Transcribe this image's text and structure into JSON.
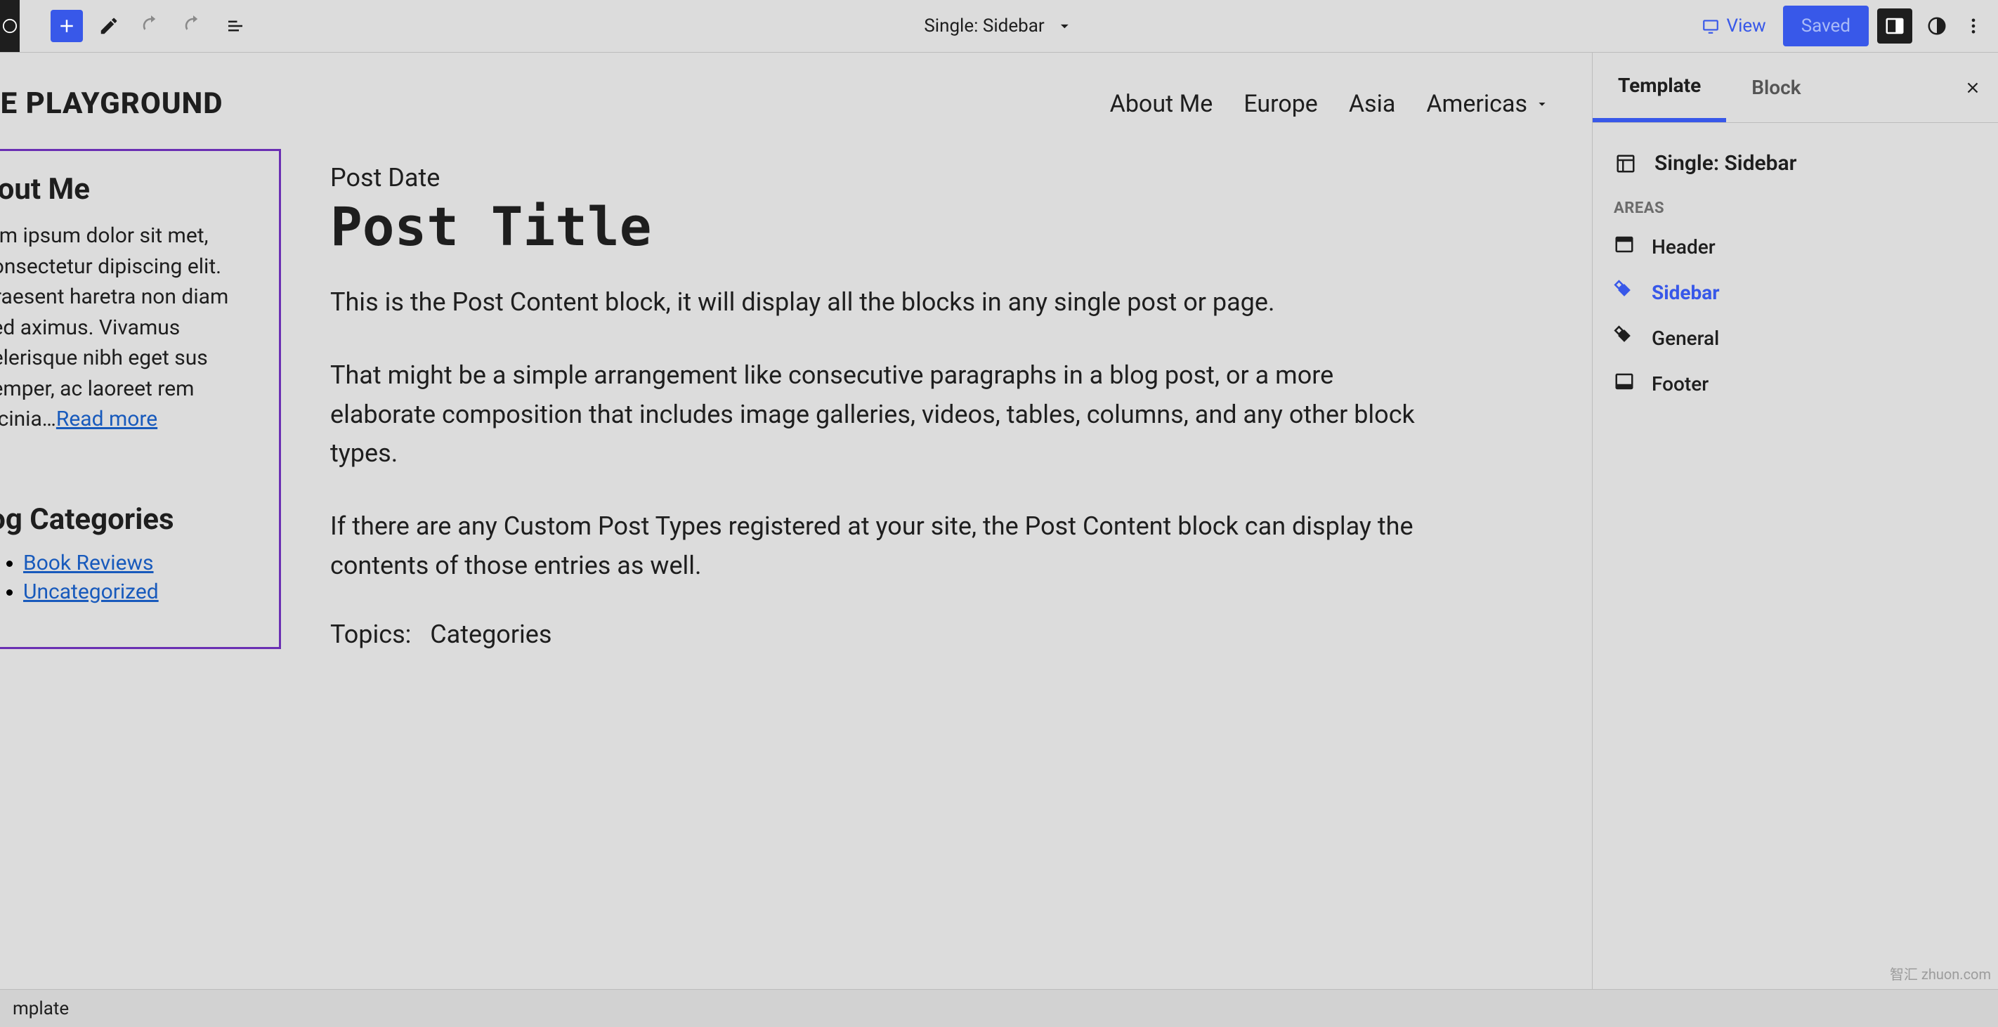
{
  "topbar": {
    "center_label": "Single: Sidebar",
    "view_label": "View",
    "saved_label": "Saved"
  },
  "site": {
    "title": "HE PLAYGROUND",
    "nav": {
      "about": "About Me",
      "europe": "Europe",
      "asia": "Asia",
      "americas": "Americas"
    }
  },
  "sidebar_block": {
    "about": {
      "heading": "bout Me",
      "text": "rem ipsum dolor sit met, consectetur dipiscing elit. Praesent haretra non diam sed aximus. Vivamus celerisque nibh eget sus semper, ac laoreet rem lacinia…",
      "read_more": "Read more "
    },
    "categories": {
      "heading": "log Categories",
      "items": {
        "0": "Book Reviews",
        "1": "Uncategorized"
      }
    }
  },
  "post": {
    "date": "Post Date",
    "title": "Post Title",
    "p1": "This is the Post Content block, it will display all the blocks in any single post or page.",
    "p2": "That might be a simple arrangement like consecutive paragraphs in a blog post, or a more elaborate composition that includes image galleries, videos, tables, columns, and any other block types.",
    "p3": "If there are any Custom Post Types registered at your site, the Post Content block can display the contents of those entries as well.",
    "topics_label": "Topics:",
    "topics_value": "Categories"
  },
  "settings": {
    "tabs": {
      "template": "Template",
      "block": "Block"
    },
    "template_name": "Single: Sidebar",
    "areas_label": "AREAS",
    "areas": {
      "header": "Header",
      "sidebar": "Sidebar",
      "general": "General",
      "footer": "Footer"
    }
  },
  "breadcrumb": "mplate",
  "watermark": "智汇 zhuon.com"
}
